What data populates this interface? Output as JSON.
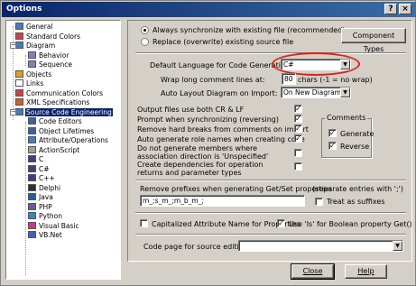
{
  "window": {
    "title": "Options",
    "help_btn": "?",
    "close_btn": "×"
  },
  "tree": {
    "items": [
      {
        "label": "General",
        "icon": "options-icon",
        "color": "#4a7ab5"
      },
      {
        "label": "Standard Colors",
        "icon": "palette-icon",
        "color": "#d04040"
      },
      {
        "label": "Diagram",
        "icon": "diagram-icon",
        "color": "#4a7ab5"
      },
      {
        "label": "Behavior",
        "icon": "behavior-icon",
        "color": "#8080c0"
      },
      {
        "label": "Sequence",
        "icon": "sequence-icon",
        "color": "#8080c0"
      },
      {
        "label": "Objects",
        "icon": "objects-icon",
        "color": "#e0a020"
      },
      {
        "label": "Links",
        "icon": "links-icon",
        "color": "#ffffff"
      },
      {
        "label": "Communication Colors",
        "icon": "palette-icon",
        "color": "#d04040"
      },
      {
        "label": "XML Specifications",
        "icon": "xml-icon",
        "color": "#d06020"
      },
      {
        "label": "Source Code Engineering",
        "icon": "code-icon",
        "color": "#4a7ab5"
      },
      {
        "label": "Code Editors",
        "icon": "editor-icon",
        "color": "#4060a0"
      },
      {
        "label": "Object Lifetimes",
        "icon": "lifetime-icon",
        "color": "#4060a0"
      },
      {
        "label": "Attribute/Operations",
        "icon": "attribute-icon",
        "color": "#4080c0"
      },
      {
        "label": "ActionScript",
        "icon": "actionscript-icon",
        "color": "#a0a0a0"
      },
      {
        "label": "C",
        "icon": "c-language-icon",
        "color": "#404080"
      },
      {
        "label": "C#",
        "icon": "csharp-icon",
        "color": "#404080"
      },
      {
        "label": "C++",
        "icon": "cpp-icon",
        "color": "#404080"
      },
      {
        "label": "Delphi",
        "icon": "delphi-icon",
        "color": "#303030"
      },
      {
        "label": "Java",
        "icon": "java-icon",
        "color": "#2060a0"
      },
      {
        "label": "PHP",
        "icon": "php-icon",
        "color": "#6060a0"
      },
      {
        "label": "Python",
        "icon": "python-icon",
        "color": "#4080c0"
      },
      {
        "label": "Visual Basic",
        "icon": "visual-basic-icon",
        "color": "#c04080"
      },
      {
        "label": "VB.Net",
        "icon": "vbnet-icon",
        "color": "#4060c0"
      }
    ],
    "selected": "Source Code Engineering"
  },
  "sync": {
    "option1": "Always synchronize with existing file (recommended)",
    "option2": "Replace (overwrite) existing source file",
    "selected": 1,
    "component_types_btn": "Component Types"
  },
  "settings": {
    "default_language_label": "Default Language for Code Generation:",
    "default_language_value": "C#",
    "wrap_label": "Wrap long comment lines at:",
    "wrap_value": "80",
    "wrap_suffix": "chars (-1 = no wrap)",
    "auto_layout_label": "Auto Layout Diagram on Import:",
    "auto_layout_value": "On New Diagram"
  },
  "options": [
    {
      "label": "Output files use both CR & LF",
      "checked": true
    },
    {
      "label": "Prompt when synchronizing (reversing)",
      "checked": true
    },
    {
      "label": "Remove hard breaks from  comments on import",
      "checked": true
    },
    {
      "label": "Auto generate role names when creating code",
      "checked": true
    },
    {
      "label": "Do not generate members where association direction is 'Unspecified'",
      "checked": false
    },
    {
      "label": "Create dependencies for operation returns and parameter types",
      "checked": false
    }
  ],
  "comments": {
    "title": "Comments",
    "generate": "Generate",
    "reverse": "Reverse",
    "generate_checked": true,
    "reverse_checked": true
  },
  "prefixes": {
    "label": "Remove prefixes when generating Get/Set properties",
    "hint": "(separate entries with ';')",
    "value": "m_;s_m_;m_b_m_;",
    "treat_suffix_label": "Treat as suffixes",
    "treat_suffix_checked": false
  },
  "capitalize": {
    "label": "Capitalized Attribute Name for Properties",
    "checked": false
  },
  "use_is": {
    "label": "Use 'Is' for Boolean property Get()",
    "checked": true
  },
  "code_page": {
    "label": "Code page for source editing:",
    "value": ""
  },
  "buttons": {
    "close": "Close",
    "help": "Help"
  },
  "colors": {
    "title_start": "#0a246a",
    "title_end": "#3a6ea5",
    "highlight_ring": "#e0201a",
    "selection": "#0a246a"
  }
}
